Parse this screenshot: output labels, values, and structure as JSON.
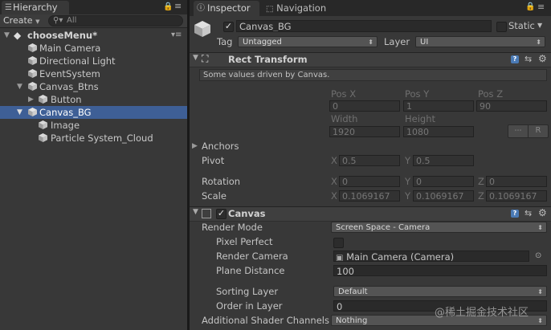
{
  "hierarchy": {
    "tab_title": "Hierarchy",
    "create_label": "Create",
    "search_placeholder": "All",
    "scene_name": "chooseMenu*",
    "items": [
      {
        "label": "Main Camera"
      },
      {
        "label": "Directional Light"
      },
      {
        "label": "EventSystem"
      },
      {
        "label": "Canvas_Btns"
      },
      {
        "label": "Button"
      },
      {
        "label": "Canvas_BG"
      },
      {
        "label": "Image"
      },
      {
        "label": "Particle System_Cloud"
      }
    ]
  },
  "inspector": {
    "tab_inspector": "Inspector",
    "tab_navigation": "Navigation",
    "object_name": "Canvas_BG",
    "static_label": "Static",
    "tag_label": "Tag",
    "tag_value": "Untagged",
    "layer_label": "Layer",
    "layer_value": "UI",
    "rect_transform": {
      "title": "Rect Transform",
      "note": "Some values driven by Canvas.",
      "pos_x_label": "Pos X",
      "pos_y_label": "Pos Y",
      "pos_z_label": "Pos Z",
      "pos_x": "0",
      "pos_y": "1",
      "pos_z": "90",
      "width_label": "Width",
      "height_label": "Height",
      "width": "1920",
      "height": "1080",
      "r_button": "R",
      "anchors_label": "Anchors",
      "pivot_label": "Pivot",
      "pivot_x": "0.5",
      "pivot_y": "0.5",
      "rotation_label": "Rotation",
      "rot_x": "0",
      "rot_y": "0",
      "rot_z": "0",
      "scale_label": "Scale",
      "scale_x": "0.1069167",
      "scale_y": "0.1069167",
      "scale_z": "0.1069167",
      "x": "X",
      "y": "Y",
      "z": "Z"
    },
    "canvas": {
      "title": "Canvas",
      "render_mode_label": "Render Mode",
      "render_mode_value": "Screen Space - Camera",
      "pixel_perfect_label": "Pixel Perfect",
      "render_camera_label": "Render Camera",
      "render_camera_value": "Main Camera (Camera)",
      "plane_distance_label": "Plane Distance",
      "plane_distance_value": "100",
      "sorting_layer_label": "Sorting Layer",
      "sorting_layer_value": "Default",
      "order_in_layer_label": "Order in Layer",
      "order_in_layer_value": "0",
      "shader_channels_label": "Additional Shader Channels",
      "shader_channels_value": "Nothing"
    },
    "watermark": "@稀土掘金技术社区"
  },
  "colors": {
    "selection": "#3e5f96",
    "panel": "#383838",
    "header": "#282828"
  }
}
